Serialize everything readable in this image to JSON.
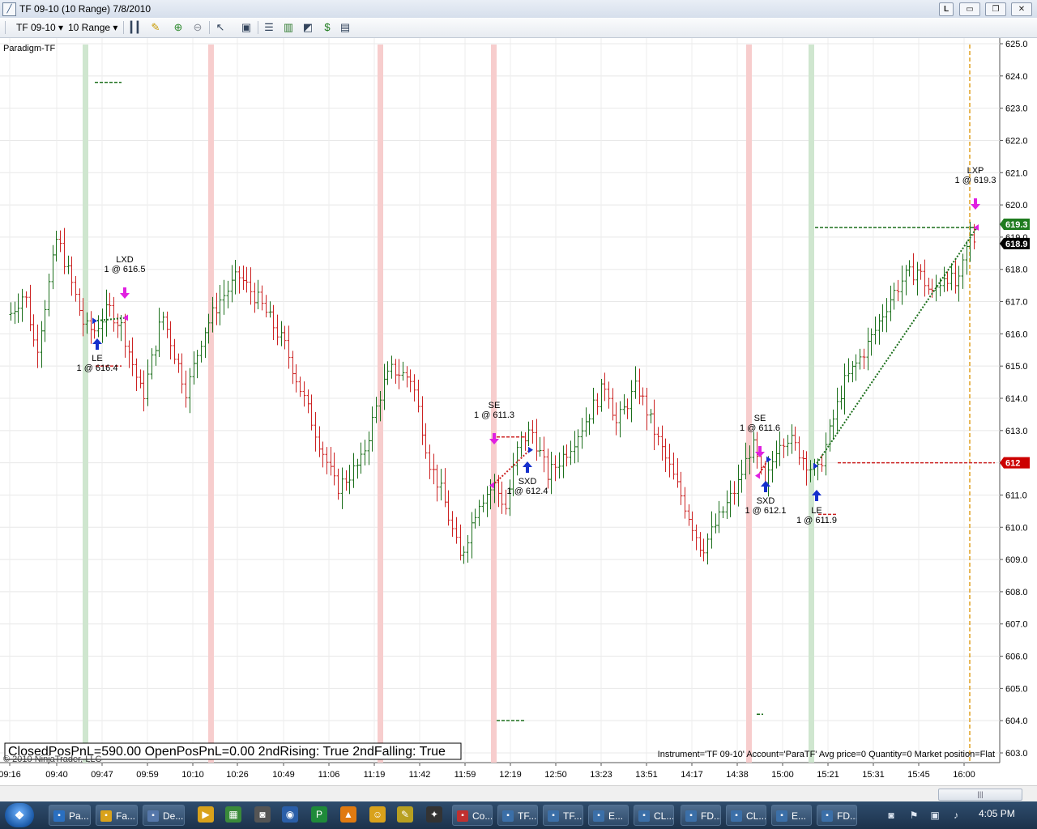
{
  "window": {
    "title": "TF 09-10 (10 Range)  7/8/2010",
    "controls": [
      "L",
      "▭",
      "❐",
      "✕"
    ]
  },
  "toolbar": {
    "instrument": "TF 09-10",
    "period": "10 Range"
  },
  "chart_data": {
    "type": "ohlc-range-bars",
    "indicator_label": "Paradigm-TF",
    "ylim": [
      603.0,
      625.0
    ],
    "y_ticks": [
      "625.0",
      "624.0",
      "623.0",
      "622.0",
      "621.0",
      "620.0",
      "619.0",
      "618.0",
      "617.0",
      "616.0",
      "615.0",
      "614.0",
      "613.0",
      "612.0",
      "611.0",
      "610.0",
      "609.0",
      "608.0",
      "607.0",
      "606.0",
      "605.0",
      "604.0",
      "603.0"
    ],
    "x_ticks": [
      "09:16",
      "09:40",
      "09:47",
      "09:59",
      "10:10",
      "10:26",
      "10:49",
      "11:06",
      "11:19",
      "11:42",
      "11:59",
      "12:19",
      "12:50",
      "13:23",
      "13:51",
      "14:17",
      "14:38",
      "15:00",
      "15:21",
      "15:31",
      "15:45",
      "16:00"
    ],
    "price_markers": [
      {
        "label": "619.3",
        "value": 619.3,
        "color": "#1e7b1e"
      },
      {
        "label": "618.9",
        "value": 618.9,
        "color": "#000000"
      },
      {
        "label": "612",
        "value": 612.0,
        "color": "#cc0000"
      }
    ],
    "up_color": "#1a6e1a",
    "down_color": "#cc2222",
    "highlight_green": "#cfe6cf",
    "highlight_red": "#f7cdcd",
    "trades": [
      {
        "label": "LE",
        "detail": "1 @ 616.4",
        "price": 616.4,
        "side": "long-entry"
      },
      {
        "label": "LXD",
        "detail": "1 @ 616.5",
        "price": 616.5,
        "side": "long-exit"
      },
      {
        "label": "SE",
        "detail": "1 @ 611.3",
        "price": 611.3,
        "side": "short-entry"
      },
      {
        "label": "SXD",
        "detail": "1 @ 612.4",
        "price": 612.4,
        "side": "short-exit"
      },
      {
        "label": "SE",
        "detail": "1 @ 611.6",
        "price": 611.6,
        "side": "short-entry"
      },
      {
        "label": "SXD",
        "detail": "1 @ 612.1",
        "price": 612.1,
        "side": "short-exit"
      },
      {
        "label": "LE",
        "detail": "1 @ 611.9",
        "price": 611.9,
        "side": "long-entry"
      },
      {
        "label": "LXP",
        "detail": "1 @ 619.3",
        "price": 619.3,
        "side": "long-exit"
      }
    ],
    "stats_text": "ClosedPosPnL=590.00 OpenPosPnL=0.00 2ndRising: True 2ndFalling: True",
    "copyright": "© 2010 NinjaTrader, LLC",
    "position_text": "Instrument='TF 09-10' Account='ParaTF' Avg price=0 Quantity=0 Market position=Flat"
  },
  "taskbar": {
    "items": [
      "Pa...",
      "Fa...",
      "De...",
      "Co...",
      "TF...",
      "TF...",
      "E...",
      "CL...",
      "FD...",
      "CL...",
      "E...",
      "FD..."
    ],
    "clock": "4:05 PM"
  }
}
